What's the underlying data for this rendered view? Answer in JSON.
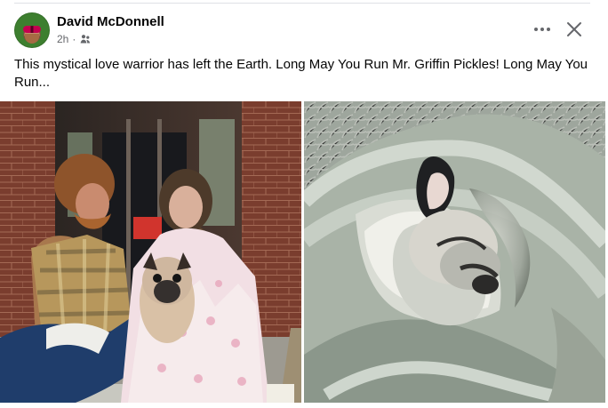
{
  "post": {
    "author_name": "David McDonnell",
    "timestamp": "2h",
    "separator": "·",
    "privacy_icon": "friends-icon",
    "text": "This mystical love warrior has left the Earth. Long May You Run Mr. Griffin Pickles! Long May You Run..."
  },
  "actions": {
    "more_icon": "more-options-icon",
    "close_icon": "close-icon"
  },
  "photos": [
    {
      "name": "couple-with-pug-photo",
      "visible_text": ""
    },
    {
      "name": "pug-in-towel-photo",
      "visible_text": ""
    }
  ],
  "colors": {
    "text_primary": "#050505",
    "text_secondary": "#65676b",
    "divider": "#dfe1e5",
    "icon": "#65676b",
    "background": "#ffffff"
  }
}
